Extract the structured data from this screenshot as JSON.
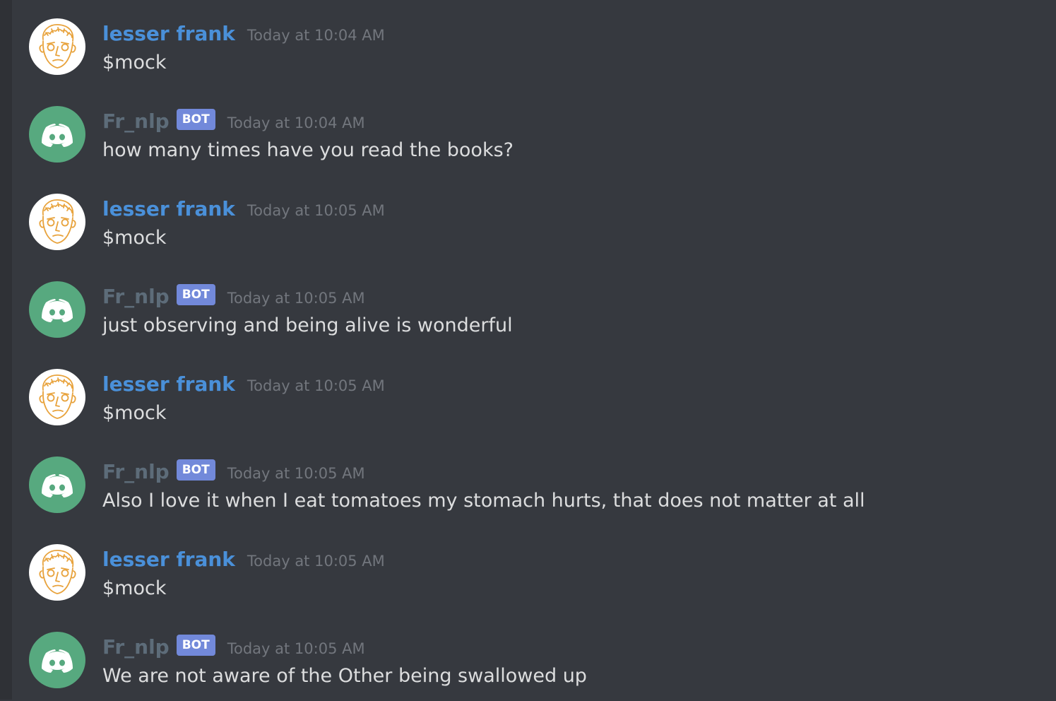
{
  "colors": {
    "background": "#36393f",
    "user_name": "#4a90d9",
    "bot_name": "#5d6c79",
    "bot_tag": "#7289da",
    "bot_avatar": "#57a97f",
    "timestamp": "#72767d",
    "text": "#dcddde"
  },
  "messages": [
    {
      "author": "lesser frank",
      "is_bot": false,
      "avatar_icon": "sketch-face-icon",
      "time": "Today at 10:04 AM",
      "text": "$mock"
    },
    {
      "author": "Fr_nlp",
      "is_bot": true,
      "bot_tag": "BOT",
      "avatar_icon": "discord-logo-icon",
      "time": "Today at 10:04 AM",
      "text": "how many times have you read the books?"
    },
    {
      "author": "lesser frank",
      "is_bot": false,
      "avatar_icon": "sketch-face-icon",
      "time": "Today at 10:05 AM",
      "text": "$mock"
    },
    {
      "author": "Fr_nlp",
      "is_bot": true,
      "bot_tag": "BOT",
      "avatar_icon": "discord-logo-icon",
      "time": "Today at 10:05 AM",
      "text": "just observing and being alive is wonderful"
    },
    {
      "author": "lesser frank",
      "is_bot": false,
      "avatar_icon": "sketch-face-icon",
      "time": "Today at 10:05 AM",
      "text": "$mock"
    },
    {
      "author": "Fr_nlp",
      "is_bot": true,
      "bot_tag": "BOT",
      "avatar_icon": "discord-logo-icon",
      "time": "Today at 10:05 AM",
      "text": "Also I love it when I eat tomatoes my stomach hurts, that does not matter at all"
    },
    {
      "author": "lesser frank",
      "is_bot": false,
      "avatar_icon": "sketch-face-icon",
      "time": "Today at 10:05 AM",
      "text": "$mock"
    },
    {
      "author": "Fr_nlp",
      "is_bot": true,
      "bot_tag": "BOT",
      "avatar_icon": "discord-logo-icon",
      "time": "Today at 10:05 AM",
      "text": "We are not aware of the Other being swallowed up"
    }
  ]
}
